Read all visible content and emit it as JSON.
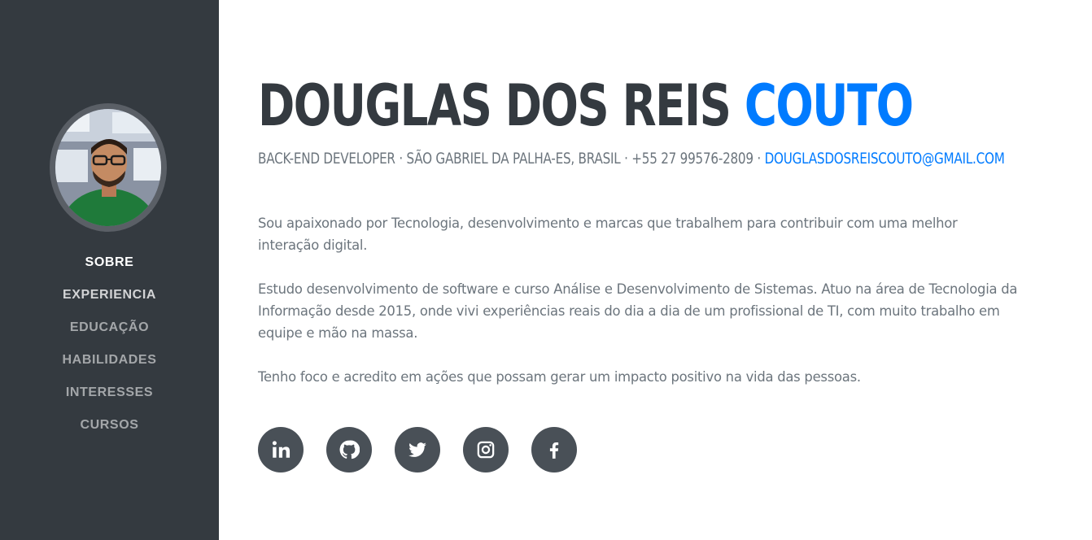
{
  "sidebar": {
    "nav_items": [
      {
        "label": "SOBRE"
      },
      {
        "label": "EXPERIENCIA"
      },
      {
        "label": "EDUCAÇÃO"
      },
      {
        "label": "HABILIDADES"
      },
      {
        "label": "INTERESSES"
      },
      {
        "label": "CURSOS"
      }
    ]
  },
  "header": {
    "first_name": "DOUGLAS DOS REIS",
    "last_name": "COUTO",
    "subheading_text": "BACK-END DEVELOPER · SÃO GABRIEL DA PALHA-ES, BRASIL · +55 27 99576-2809 · ",
    "email": "DOUGLASDOSREISCOUTO@GMAIL.COM"
  },
  "about": {
    "paragraphs": [
      "Sou apaixonado por Tecnologia, desenvolvimento e marcas que trabalhem para contribuir com uma melhor interação digital.",
      "Estudo desenvolvimento de software e curso Análise e Desenvolvimento de Sistemas. Atuo na área de Tecnologia da Informação desde 2015, onde vivi experiências reais do dia a dia de um profissional de TI, com muito trabalho em equipe e mão na massa.",
      "Tenho foco e acredito em ações que possam gerar um impacto positivo na vida das pessoas."
    ]
  },
  "social": [
    {
      "icon": "linkedin-icon"
    },
    {
      "icon": "github-icon"
    },
    {
      "icon": "twitter-icon"
    },
    {
      "icon": "instagram-icon"
    },
    {
      "icon": "facebook-icon"
    }
  ],
  "colors": {
    "sidebar_bg": "#343a40",
    "accent": "#007bff",
    "text_dark": "#343a40",
    "text_muted": "#6c757d",
    "social_bg": "#495057"
  }
}
